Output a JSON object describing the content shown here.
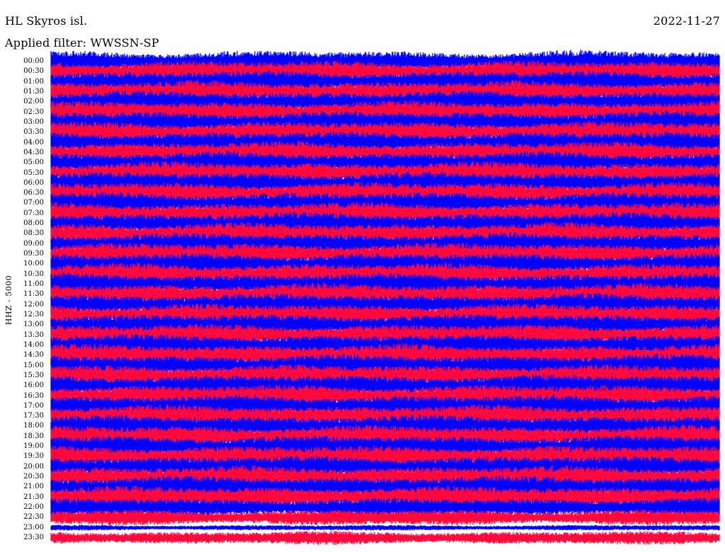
{
  "header": {
    "station": "HL Skyros isl.",
    "date": "2022-11-27",
    "filter": "Applied filter: WWSSN-SP"
  },
  "channel_label": "HHZ - 5000",
  "colors": {
    "trace_odd": "#0000ff",
    "trace_even": "#ff0a3c",
    "background": "#ffffff",
    "text": "#000000"
  },
  "chart_data": {
    "type": "line",
    "subtype": "helicorder",
    "title": "HL Skyros isl.",
    "date": "2022-11-27",
    "filter": "WWSSN-SP",
    "ylabel": "HHZ - 5000",
    "xlabel": "",
    "row_interval_minutes": 30,
    "rows": [
      {
        "time": "00:00",
        "color": "#0000ff",
        "amplitude": 1.0
      },
      {
        "time": "00:30",
        "color": "#ff0a3c",
        "amplitude": 1.0
      },
      {
        "time": "01:00",
        "color": "#0000ff",
        "amplitude": 1.0
      },
      {
        "time": "01:30",
        "color": "#ff0a3c",
        "amplitude": 1.0
      },
      {
        "time": "02:00",
        "color": "#0000ff",
        "amplitude": 1.0
      },
      {
        "time": "02:30",
        "color": "#ff0a3c",
        "amplitude": 1.0
      },
      {
        "time": "03:00",
        "color": "#0000ff",
        "amplitude": 1.0
      },
      {
        "time": "03:30",
        "color": "#ff0a3c",
        "amplitude": 1.0
      },
      {
        "time": "04:00",
        "color": "#0000ff",
        "amplitude": 1.0
      },
      {
        "time": "04:30",
        "color": "#ff0a3c",
        "amplitude": 1.0
      },
      {
        "time": "05:00",
        "color": "#0000ff",
        "amplitude": 1.0
      },
      {
        "time": "05:30",
        "color": "#ff0a3c",
        "amplitude": 1.0
      },
      {
        "time": "06:00",
        "color": "#0000ff",
        "amplitude": 1.0
      },
      {
        "time": "06:30",
        "color": "#ff0a3c",
        "amplitude": 1.0
      },
      {
        "time": "07:00",
        "color": "#0000ff",
        "amplitude": 1.0
      },
      {
        "time": "07:30",
        "color": "#ff0a3c",
        "amplitude": 1.0
      },
      {
        "time": "08:00",
        "color": "#0000ff",
        "amplitude": 1.0
      },
      {
        "time": "08:30",
        "color": "#ff0a3c",
        "amplitude": 1.0
      },
      {
        "time": "09:00",
        "color": "#0000ff",
        "amplitude": 1.0
      },
      {
        "time": "09:30",
        "color": "#ff0a3c",
        "amplitude": 1.0
      },
      {
        "time": "10:00",
        "color": "#0000ff",
        "amplitude": 1.0
      },
      {
        "time": "10:30",
        "color": "#ff0a3c",
        "amplitude": 1.0
      },
      {
        "time": "11:00",
        "color": "#0000ff",
        "amplitude": 1.0
      },
      {
        "time": "11:30",
        "color": "#ff0a3c",
        "amplitude": 1.0
      },
      {
        "time": "12:00",
        "color": "#0000ff",
        "amplitude": 1.0
      },
      {
        "time": "12:30",
        "color": "#ff0a3c",
        "amplitude": 1.0
      },
      {
        "time": "13:00",
        "color": "#0000ff",
        "amplitude": 1.0
      },
      {
        "time": "13:30",
        "color": "#ff0a3c",
        "amplitude": 1.0
      },
      {
        "time": "14:00",
        "color": "#0000ff",
        "amplitude": 1.0
      },
      {
        "time": "14:30",
        "color": "#ff0a3c",
        "amplitude": 1.0
      },
      {
        "time": "15:00",
        "color": "#0000ff",
        "amplitude": 1.0
      },
      {
        "time": "15:30",
        "color": "#ff0a3c",
        "amplitude": 1.0
      },
      {
        "time": "16:00",
        "color": "#0000ff",
        "amplitude": 1.0
      },
      {
        "time": "16:30",
        "color": "#ff0a3c",
        "amplitude": 1.0
      },
      {
        "time": "17:00",
        "color": "#0000ff",
        "amplitude": 1.0
      },
      {
        "time": "17:30",
        "color": "#ff0a3c",
        "amplitude": 1.0
      },
      {
        "time": "18:00",
        "color": "#0000ff",
        "amplitude": 1.0
      },
      {
        "time": "18:30",
        "color": "#ff0a3c",
        "amplitude": 1.0
      },
      {
        "time": "19:00",
        "color": "#0000ff",
        "amplitude": 1.0
      },
      {
        "time": "19:30",
        "color": "#ff0a3c",
        "amplitude": 1.0
      },
      {
        "time": "20:00",
        "color": "#0000ff",
        "amplitude": 1.0
      },
      {
        "time": "20:30",
        "color": "#ff0a3c",
        "amplitude": 1.0
      },
      {
        "time": "21:00",
        "color": "#0000ff",
        "amplitude": 1.0
      },
      {
        "time": "21:30",
        "color": "#ff0a3c",
        "amplitude": 1.0
      },
      {
        "time": "22:00",
        "color": "#0000ff",
        "amplitude": 0.85
      },
      {
        "time": "22:30",
        "color": "#ff0a3c",
        "amplitude": 0.7
      },
      {
        "time": "23:00",
        "color": "#0000ff",
        "amplitude": 0.25
      },
      {
        "time": "23:30",
        "color": "#ff0a3c",
        "amplitude": 0.6
      }
    ]
  }
}
